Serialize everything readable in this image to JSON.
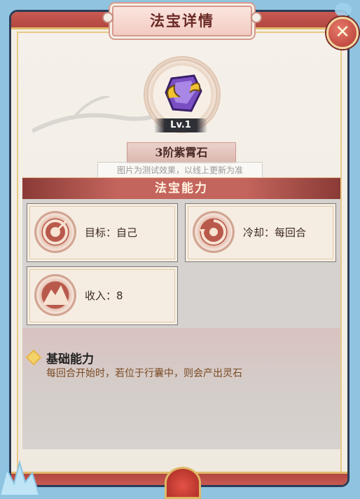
{
  "dialog": {
    "title": "法宝详情",
    "close_icon_glyph": "✕"
  },
  "item": {
    "level": "Lv.1",
    "name": "3阶紫霄石",
    "test_notice": "图片为测试效果，以线上更新为准",
    "icon": "purple-gem-icon"
  },
  "ability_section": {
    "title": "法宝能力",
    "cards": [
      {
        "label": "目标：自己",
        "icon": "target-icon"
      },
      {
        "label": "冷却：每回合",
        "icon": "cooldown-icon"
      },
      {
        "label": "收入：8",
        "icon": "mountain-icon"
      }
    ]
  },
  "basic_ability": {
    "title": "基础能力",
    "description": "每回合开始时，若位于行囊中，则会产出灵石"
  },
  "colors": {
    "frame_red": "#c95a52",
    "gold_trim": "#e2b96a",
    "panel_bg": "#d6d2cf",
    "accent_text": "#7a4a22"
  }
}
